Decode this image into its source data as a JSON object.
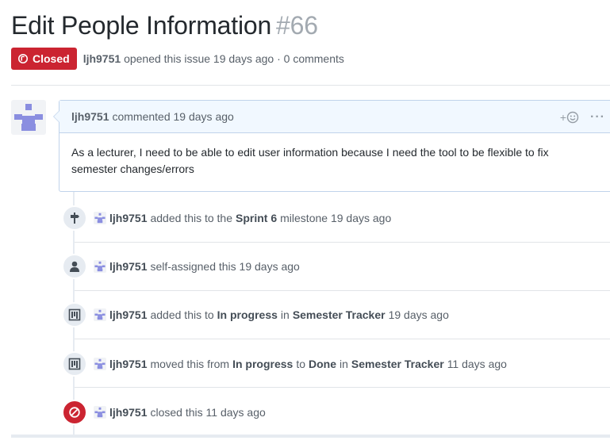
{
  "issue": {
    "title": "Edit People Information",
    "number": "#66",
    "state_label": "Closed",
    "state_color": "#cb2431",
    "author": "ljh9751",
    "opened_text": "opened this issue 19 days ago · 0 comments"
  },
  "comment": {
    "author": "ljh9751",
    "header_text": "commented 19 days ago",
    "reaction_plus": "+",
    "more": "···",
    "body": "As a lecturer, I need to be able to edit user information because I need the tool to be flexible to fix semester changes/errors"
  },
  "events": [
    {
      "icon": "milestone-icon",
      "user": "ljh9751",
      "t1": "added this to the",
      "b1": "Sprint 6",
      "t2": "milestone 19 days ago"
    },
    {
      "icon": "person-icon",
      "user": "ljh9751",
      "t1": "self-assigned this 19 days ago"
    },
    {
      "icon": "project-icon",
      "user": "ljh9751",
      "t1": "added this to",
      "b1": "In progress",
      "t2": "in",
      "b2": "Semester Tracker",
      "t3": "19 days ago"
    },
    {
      "icon": "project-icon",
      "user": "ljh9751",
      "t1": "moved this from",
      "b1": "In progress",
      "t2": "to",
      "b2": "Done",
      "t3": "in",
      "b3": "Semester Tracker",
      "t4": "11 days ago"
    },
    {
      "icon": "closed-circle-icon",
      "user": "ljh9751",
      "t1": "closed this 11 days ago"
    }
  ],
  "colors": {
    "closed_red": "#cb2431",
    "avatar_purple": "#8a8ee0",
    "comment_border": "#c0d3eb",
    "comment_header_bg": "#f1f8ff"
  }
}
